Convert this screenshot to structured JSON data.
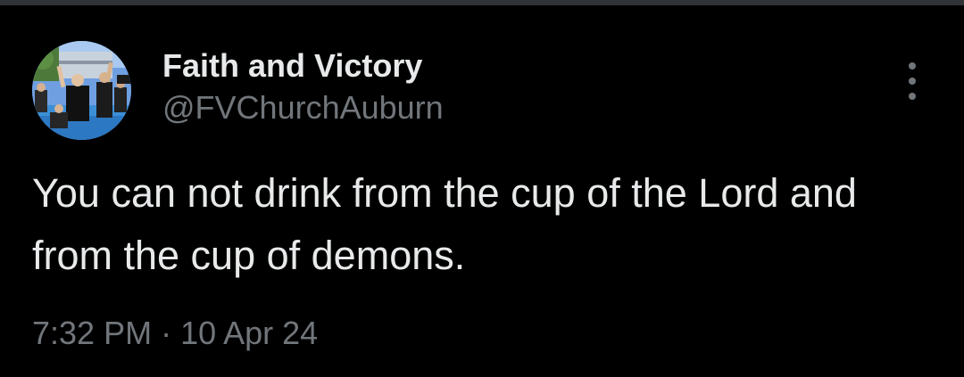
{
  "author": {
    "display_name": "Faith and Victory",
    "handle": "@FVChurchAuburn",
    "avatar_icon": "profile-photo"
  },
  "tweet": {
    "text": "You can not drink from the cup of the Lord and from the cup of demons.",
    "time": "7:32 PM",
    "separator": "·",
    "date": "10 Apr 24"
  },
  "menu": {
    "icon": "more-options-icon"
  },
  "colors": {
    "background": "#000000",
    "primary_text": "#e7e9ea",
    "secondary_text": "#71767b",
    "divider": "#2f3336"
  }
}
